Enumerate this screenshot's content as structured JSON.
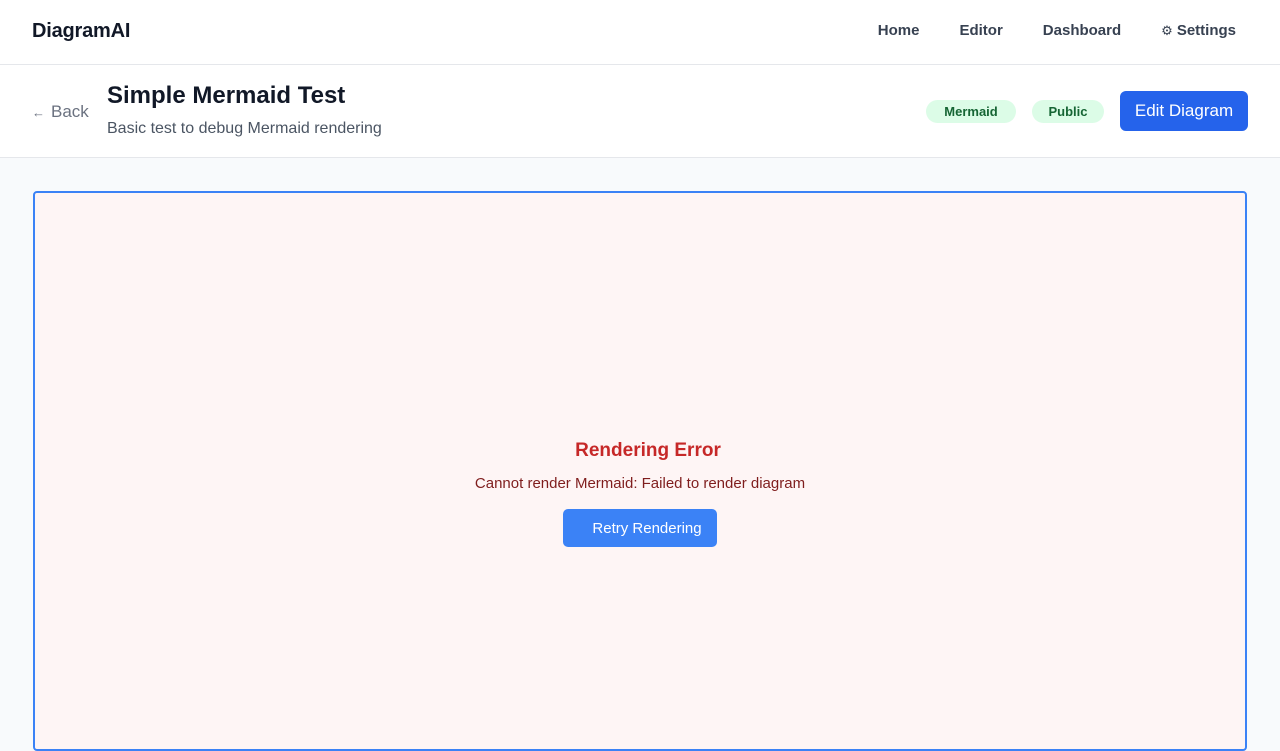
{
  "app": {
    "name": "DiagramAI"
  },
  "nav": {
    "items": [
      {
        "label": "Home"
      },
      {
        "label": "Editor"
      },
      {
        "label": "Dashboard"
      },
      {
        "label": "Settings",
        "icon": "gear-icon"
      }
    ],
    "gear_glyph": "⚙"
  },
  "header": {
    "back_label": "Back",
    "back_arrow": "←",
    "title": "Simple Mermaid Test",
    "description": "Basic test to debug Mermaid rendering",
    "badges": [
      {
        "label": "Mermaid"
      },
      {
        "label": "Public"
      }
    ],
    "edit_label": "Edit Diagram"
  },
  "canvas": {
    "error_title": "Rendering Error",
    "error_message": "Cannot render Mermaid: Failed to render diagram",
    "retry_label": "Retry Rendering"
  },
  "colors": {
    "primary": "#2563eb",
    "retry": "#3b82f6",
    "error": "#c62828",
    "badge_bg": "#dcfce7",
    "badge_text": "#166534",
    "canvas_bg": "#fef5f5"
  }
}
